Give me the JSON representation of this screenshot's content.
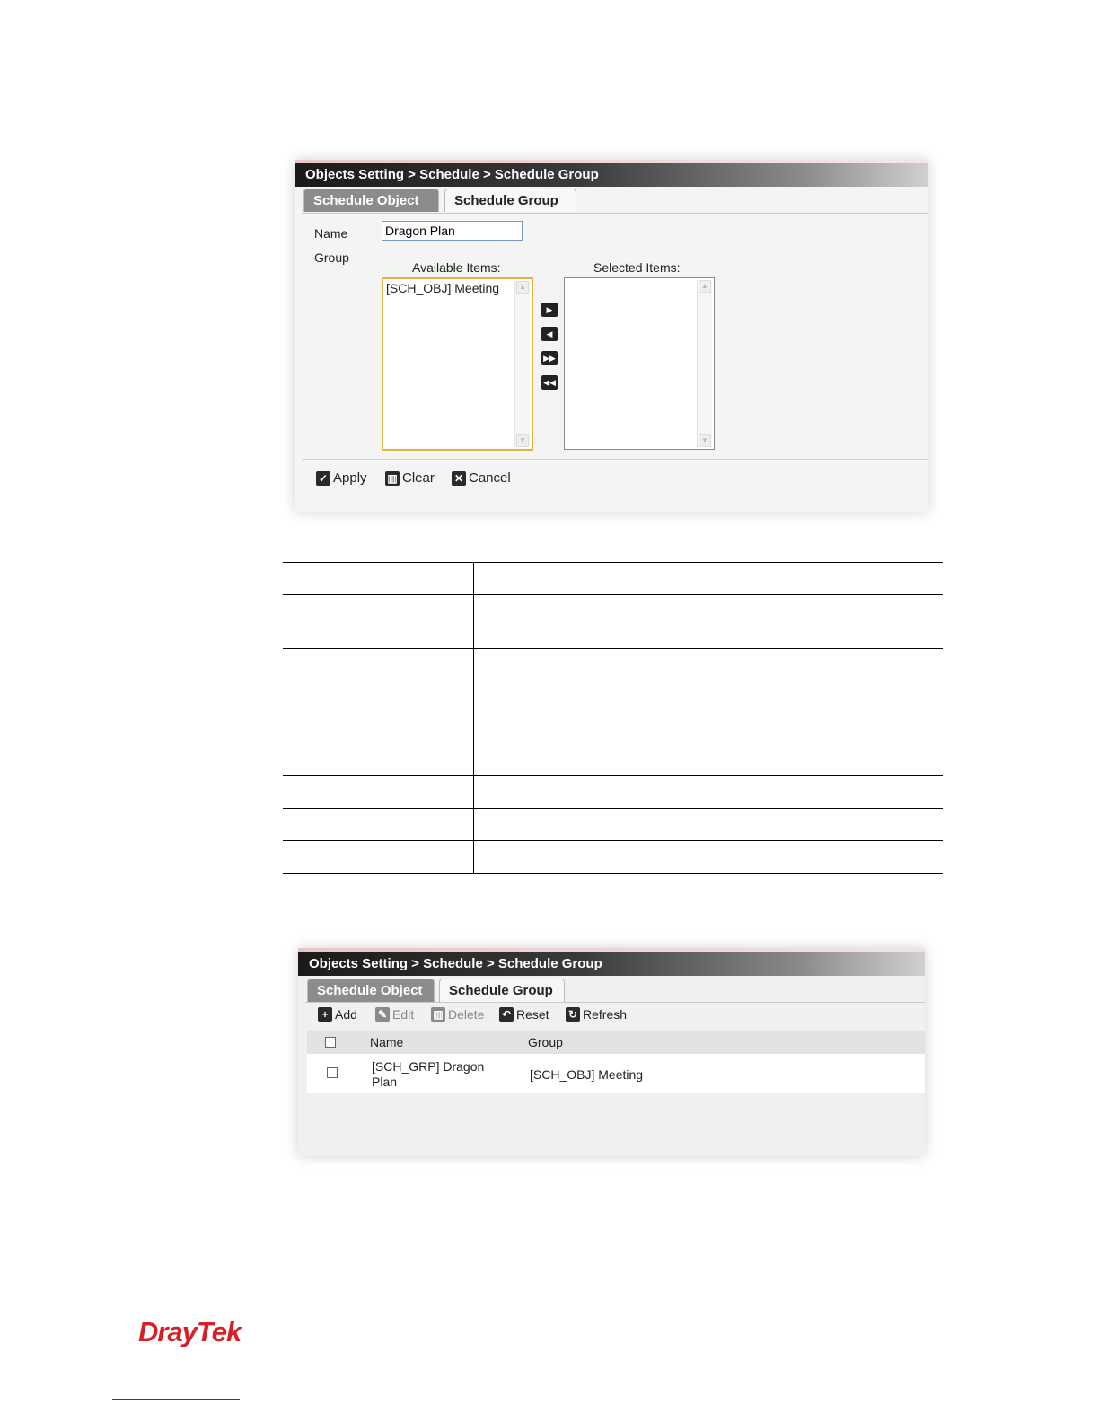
{
  "form_screenshot": {
    "breadcrumb": "Objects Setting > Schedule > Schedule Group",
    "tabs": [
      "Schedule Object",
      "Schedule Group"
    ],
    "name_label": "Name",
    "name_value": "Dragon Plan",
    "group_label": "Group",
    "available_label": "Available Items:",
    "available_items": [
      "[SCH_OBJ] Meeting"
    ],
    "selected_label": "Selected Items:",
    "selected_items": [],
    "move_buttons": [
      "move-right-icon",
      "move-left-icon",
      "move-all-right-icon",
      "move-all-left-icon"
    ],
    "actions": {
      "apply": "Apply",
      "clear": "Clear",
      "cancel": "Cancel"
    }
  },
  "list_screenshot": {
    "breadcrumb": "Objects Setting > Schedule > Schedule Group",
    "tabs": [
      "Schedule Object",
      "Schedule Group"
    ],
    "toolbar": {
      "add": "Add",
      "edit": "Edit",
      "delete": "Delete",
      "reset": "Reset",
      "refresh": "Refresh"
    },
    "columns": {
      "name": "Name",
      "group": "Group"
    },
    "rows": [
      {
        "name_line1": "[SCH_GRP] Dragon",
        "name_line2": "Plan",
        "group": "[SCH_OBJ] Meeting"
      }
    ]
  },
  "footer": {
    "logo": "DrayTek"
  },
  "colors": {
    "logo_red": "#d81e27",
    "titlebar_dark": "#1a1a1a",
    "inactive_tab": "#8c8c8c",
    "focus_border": "#e8b84a"
  }
}
